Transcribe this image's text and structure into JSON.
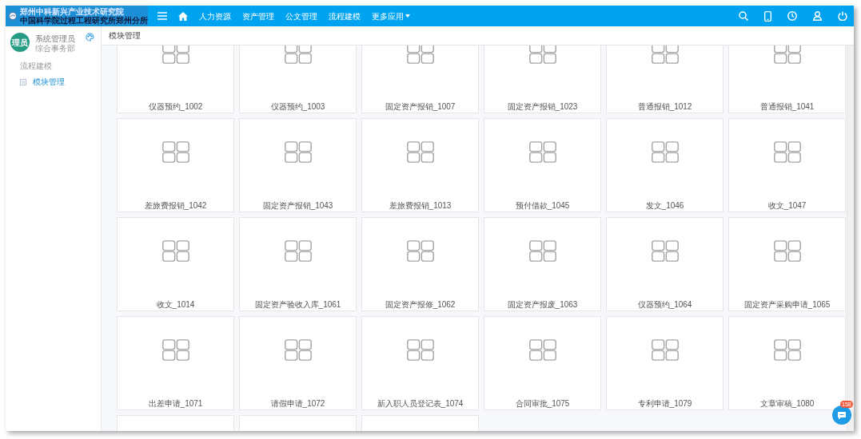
{
  "header": {
    "logo_lines": [
      "郑州中科新兴产业技术研究院",
      "中国科学院过程工程研究所郑州分所"
    ],
    "nav": [
      {
        "kind": "menu"
      },
      {
        "kind": "home"
      },
      {
        "kind": "link",
        "label": "人力资源"
      },
      {
        "kind": "link",
        "label": "资产管理"
      },
      {
        "kind": "link",
        "label": "公文管理"
      },
      {
        "kind": "link",
        "label": "流程建模"
      },
      {
        "kind": "dropdown",
        "label": "更多应用"
      }
    ],
    "actions": [
      {
        "kind": "search"
      },
      {
        "kind": "phone"
      },
      {
        "kind": "clock"
      },
      {
        "kind": "user"
      },
      {
        "kind": "power"
      }
    ]
  },
  "sidebar": {
    "avatar": "理员",
    "user_name": "系统管理员",
    "department": "综合事务部",
    "section": "流程建模",
    "items": [
      {
        "label": "模块管理",
        "selected": true
      }
    ]
  },
  "breadcrumb": "模块管理",
  "modules": [
    {
      "kind": "card",
      "label": "仪器预约_1002"
    },
    {
      "kind": "card",
      "label": "仪器预约_1003"
    },
    {
      "kind": "card",
      "label": "固定资产报销_1007"
    },
    {
      "kind": "card",
      "label": "固定资产报销_1023"
    },
    {
      "kind": "card",
      "label": "普通报销_1012"
    },
    {
      "kind": "card",
      "label": "普通报销_1041"
    },
    {
      "kind": "card",
      "label": "差旅费报销_1042"
    },
    {
      "kind": "card",
      "label": "固定资产报销_1043"
    },
    {
      "kind": "card",
      "label": "差旅费报销_1013"
    },
    {
      "kind": "card",
      "label": "预付借款_1045"
    },
    {
      "kind": "card",
      "label": "发文_1046"
    },
    {
      "kind": "card",
      "label": "收文_1047"
    },
    {
      "kind": "card",
      "label": "收文_1014"
    },
    {
      "kind": "card",
      "label": "固定资产验收入库_1061"
    },
    {
      "kind": "card",
      "label": "固定资产报修_1062"
    },
    {
      "kind": "card",
      "label": "固定资产报废_1063"
    },
    {
      "kind": "card",
      "label": "仪器预约_1064"
    },
    {
      "kind": "card",
      "label": "固定资产采购申请_1065"
    },
    {
      "kind": "card",
      "label": "出差申请_1071"
    },
    {
      "kind": "card",
      "label": "请假申请_1072"
    },
    {
      "kind": "card",
      "label": "新入职人员登记表_1074"
    },
    {
      "kind": "card",
      "label": "合同审批_1075"
    },
    {
      "kind": "card",
      "label": "专利申请_1079"
    },
    {
      "kind": "card",
      "label": "文章审稿_1080"
    },
    {
      "kind": "cut"
    },
    {
      "kind": "cut"
    },
    {
      "kind": "cut"
    }
  ],
  "chat_badge": "158"
}
